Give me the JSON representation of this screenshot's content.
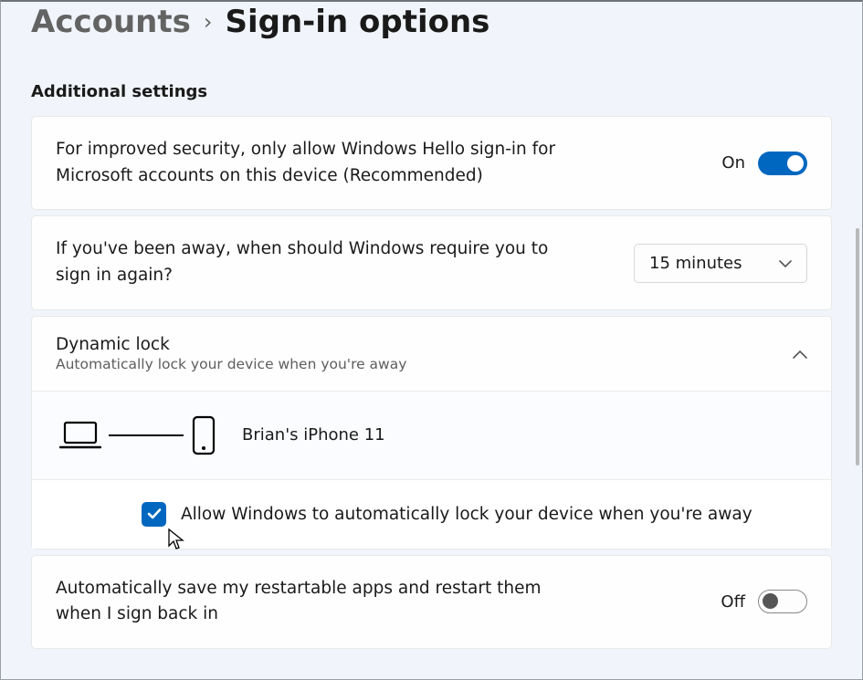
{
  "breadcrumb": {
    "parent": "Accounts",
    "current": "Sign-in options"
  },
  "section_header": "Additional settings",
  "hello_row": {
    "text": "For improved security, only allow Windows Hello sign-in for Microsoft accounts on this device (Recommended)",
    "state_label": "On",
    "state": true
  },
  "away_row": {
    "text": "If you've been away, when should Windows require you to sign in again?",
    "select_value": "15 minutes"
  },
  "dynamic_lock": {
    "title": "Dynamic lock",
    "subtitle": "Automatically lock your device when you're away",
    "device_name": "Brian's iPhone 11",
    "checkbox_label": "Allow Windows to automatically lock your device when you're away",
    "checked": true
  },
  "restart_row": {
    "text": "Automatically save my restartable apps and restart them when I sign back in",
    "state_label": "Off",
    "state": false
  }
}
